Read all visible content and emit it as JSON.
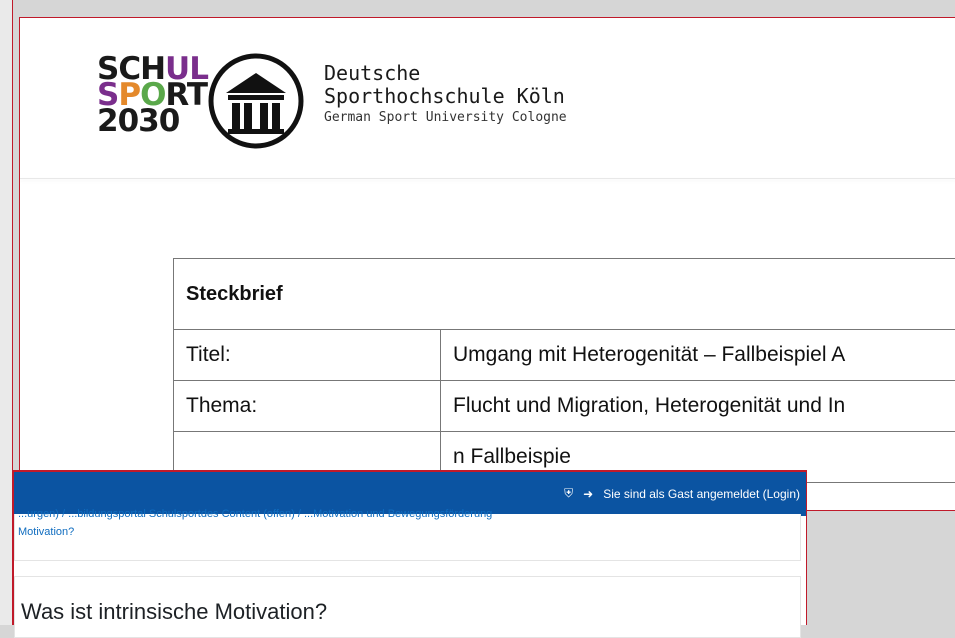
{
  "document": {
    "logo": {
      "line1": "SCHUL",
      "line2": "SPORT",
      "line3": "2030",
      "colors": {
        "dark": "#1a1a1a",
        "purple": "#7a2e8c",
        "orange": "#e4892b",
        "green": "#5aa84a"
      }
    },
    "university": {
      "name_line1": "Deutsche",
      "name_line2": "Sporthochschule Köln",
      "name_en": "German Sport University Cologne"
    },
    "table": {
      "heading": "Steckbrief",
      "rows": [
        {
          "label": "Titel:",
          "value": "Umgang mit Heterogenität – Fallbeispiel A"
        },
        {
          "label": "Thema:",
          "value": "Flucht und Migration, Heterogenität und In"
        },
        {
          "label": "",
          "value": "n  Fallbeispie"
        }
      ]
    }
  },
  "navbar": {
    "home_icon": "home-icon",
    "login_icon": "sign-in-icon",
    "login_text": "Sie sind als Gast angemeldet (Login)",
    "color": "#0b54a2"
  },
  "breadcrumb": {
    "line1": "...urgen) / ...bildungsportal Schulsportdes Content (offen) / ...Motivation und Bewegungsförderung",
    "line2": "Motivation?"
  },
  "page": {
    "title": "Was ist intrinsische Motivation?"
  }
}
